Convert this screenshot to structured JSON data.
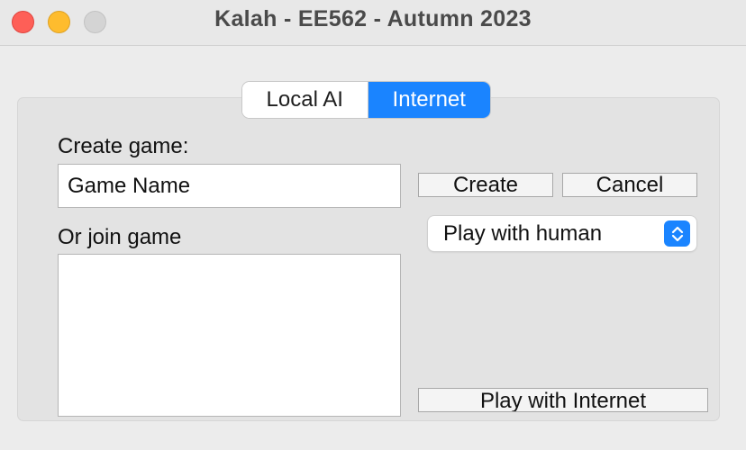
{
  "window": {
    "title": "Kalah - EE562 - Autumn 2023"
  },
  "tabs": [
    {
      "label": "Local AI",
      "selected": false
    },
    {
      "label": "Internet",
      "selected": true
    }
  ],
  "internet": {
    "create_label": "Create game:",
    "game_name_value": "Game Name",
    "create_button": "Create",
    "cancel_button": "Cancel",
    "join_label": "Or join game",
    "mode_select_value": "Play with human",
    "play_button": "Play with Internet",
    "games_list": []
  },
  "colors": {
    "accent": "#1a84ff",
    "close": "#fe5f57",
    "minimize": "#febc2e",
    "maximize": "#d4d4d4"
  }
}
